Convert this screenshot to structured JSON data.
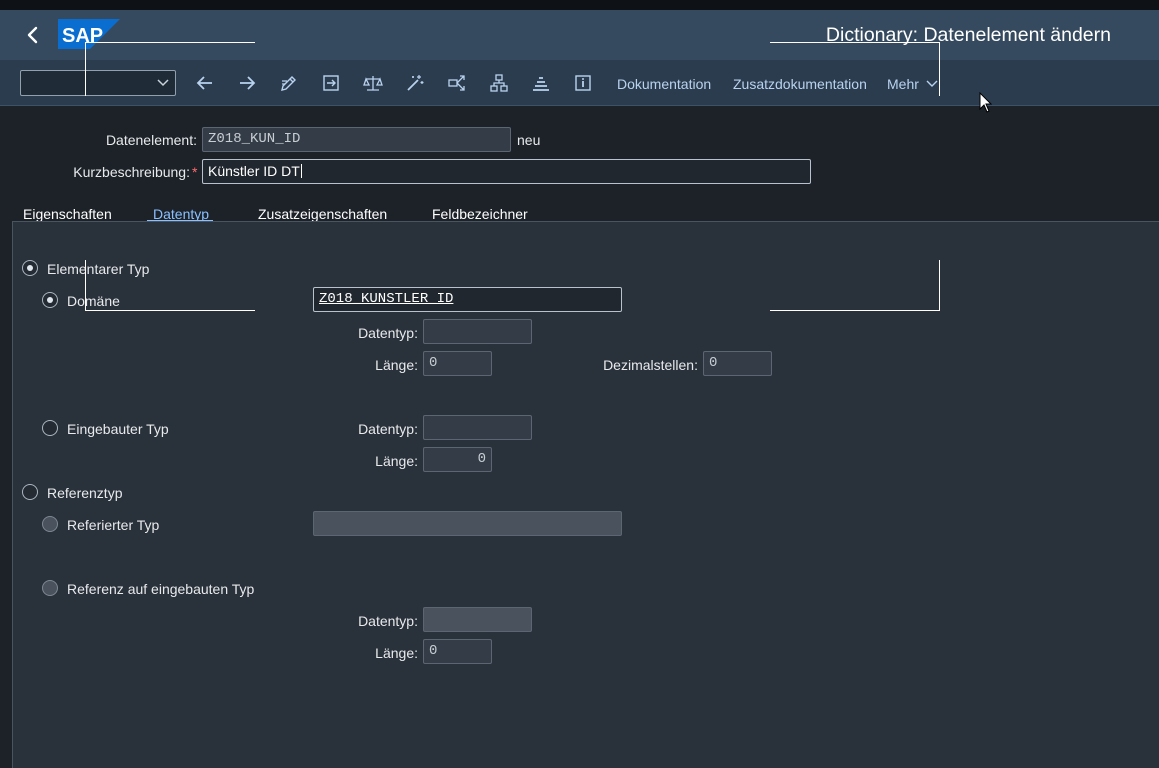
{
  "header": {
    "title": "Dictionary: Datenelement ändern",
    "logo_text": "SAP",
    "brand_color": "#0a6ed1"
  },
  "toolbar": {
    "command_field_value": "",
    "icons": [
      "arrow-left-icon",
      "arrow-right-icon",
      "edit-pencil-icon",
      "where-used-icon",
      "balance-check-icon",
      "magic-wand-icon",
      "share-icon",
      "hierarchy-icon",
      "stack-icon",
      "info-icon"
    ],
    "links": {
      "documentation": "Dokumentation",
      "additional_documentation": "Zusatzdokumentation",
      "more": "Mehr"
    }
  },
  "form": {
    "data_element_label": "Datenelement:",
    "data_element_value": "Z018_KUN_ID",
    "data_element_status": "neu",
    "short_desc_label": "Kurzbeschreibung:",
    "short_desc_required": "*",
    "short_desc_value": "Künstler ID DT"
  },
  "tabs": [
    {
      "label": "Eigenschaften",
      "selected": false
    },
    {
      "label": "Datentyp",
      "selected": true
    },
    {
      "label": "Zusatzeigenschaften",
      "selected": false
    },
    {
      "label": "Feldbezeichner",
      "selected": false
    }
  ],
  "datatype_panel": {
    "elementary": {
      "label": "Elementarer Typ",
      "selected": true,
      "domain": {
        "label": "Domäne",
        "selected": true,
        "value": "Z018_KUNSTLER_ID",
        "datatype_label": "Datentyp:",
        "datatype_value": "",
        "length_label": "Länge:",
        "length_value": "0",
        "decimals_label": "Dezimalstellen:",
        "decimals_value": "0"
      },
      "builtin": {
        "label": "Eingebauter Typ",
        "selected": false,
        "datatype_label": "Datentyp:",
        "datatype_value": "",
        "length_label": "Länge:",
        "length_value": "0"
      }
    },
    "reference": {
      "label": "Referenztyp",
      "selected": false,
      "referenced": {
        "label": "Referierter Typ",
        "selected": false,
        "value": ""
      },
      "builtin_ref": {
        "label": "Referenz auf eingebauten Typ",
        "selected": false,
        "datatype_label": "Datentyp:",
        "datatype_value": "",
        "length_label": "Länge:",
        "length_value": "0"
      }
    }
  }
}
